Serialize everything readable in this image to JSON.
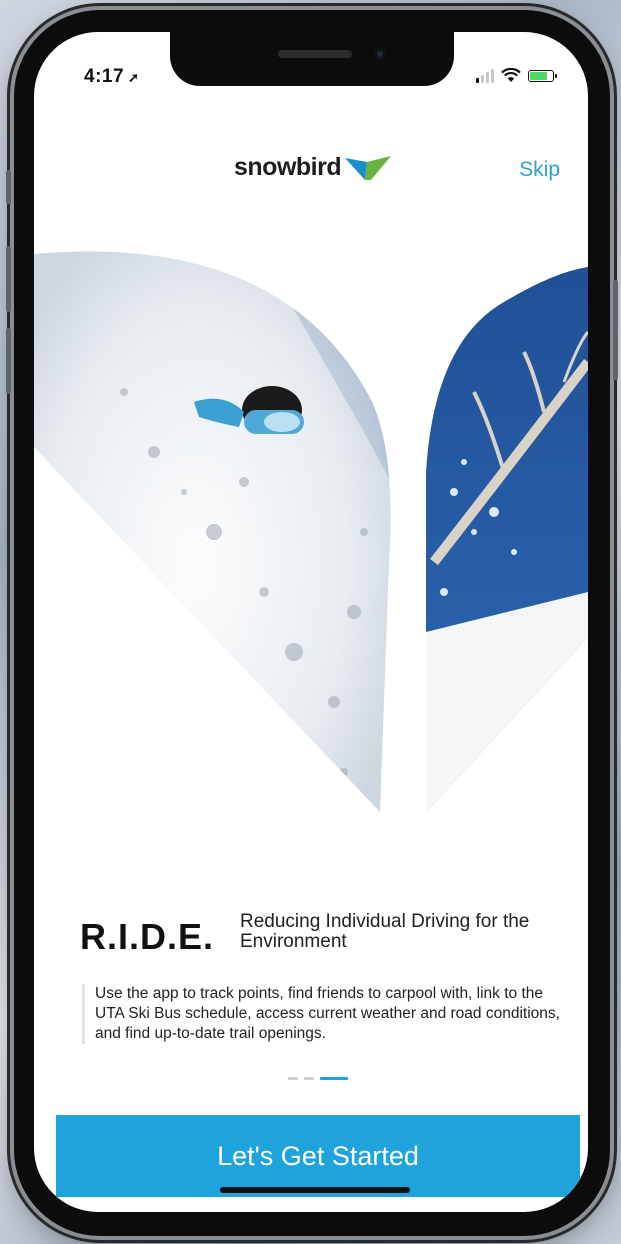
{
  "status_bar": {
    "time": "4:17",
    "location_arrow": "location-arrow-icon",
    "signal_bars_on": 1,
    "battery_level": 0.7,
    "battery_color": "#4cd964"
  },
  "header": {
    "brand": "snowbird",
    "skip_label": "Skip"
  },
  "onboarding": {
    "title": "R.I.D.E.",
    "subtitle": "Reducing Individual Driving for the Environment",
    "description": "Use the app to track points, find friends to carpool with, link to the UTA Ski Bus schedule, access current weather and road conditions, and find up-to-date trail openings.",
    "page_count": 3,
    "current_page": 3
  },
  "cta": {
    "label": "Let's Get Started",
    "color": "#1ea3dc"
  },
  "colors": {
    "accent": "#2e9fd3",
    "logo_blue": "#1a8fd0",
    "logo_green": "#6ab23e"
  }
}
